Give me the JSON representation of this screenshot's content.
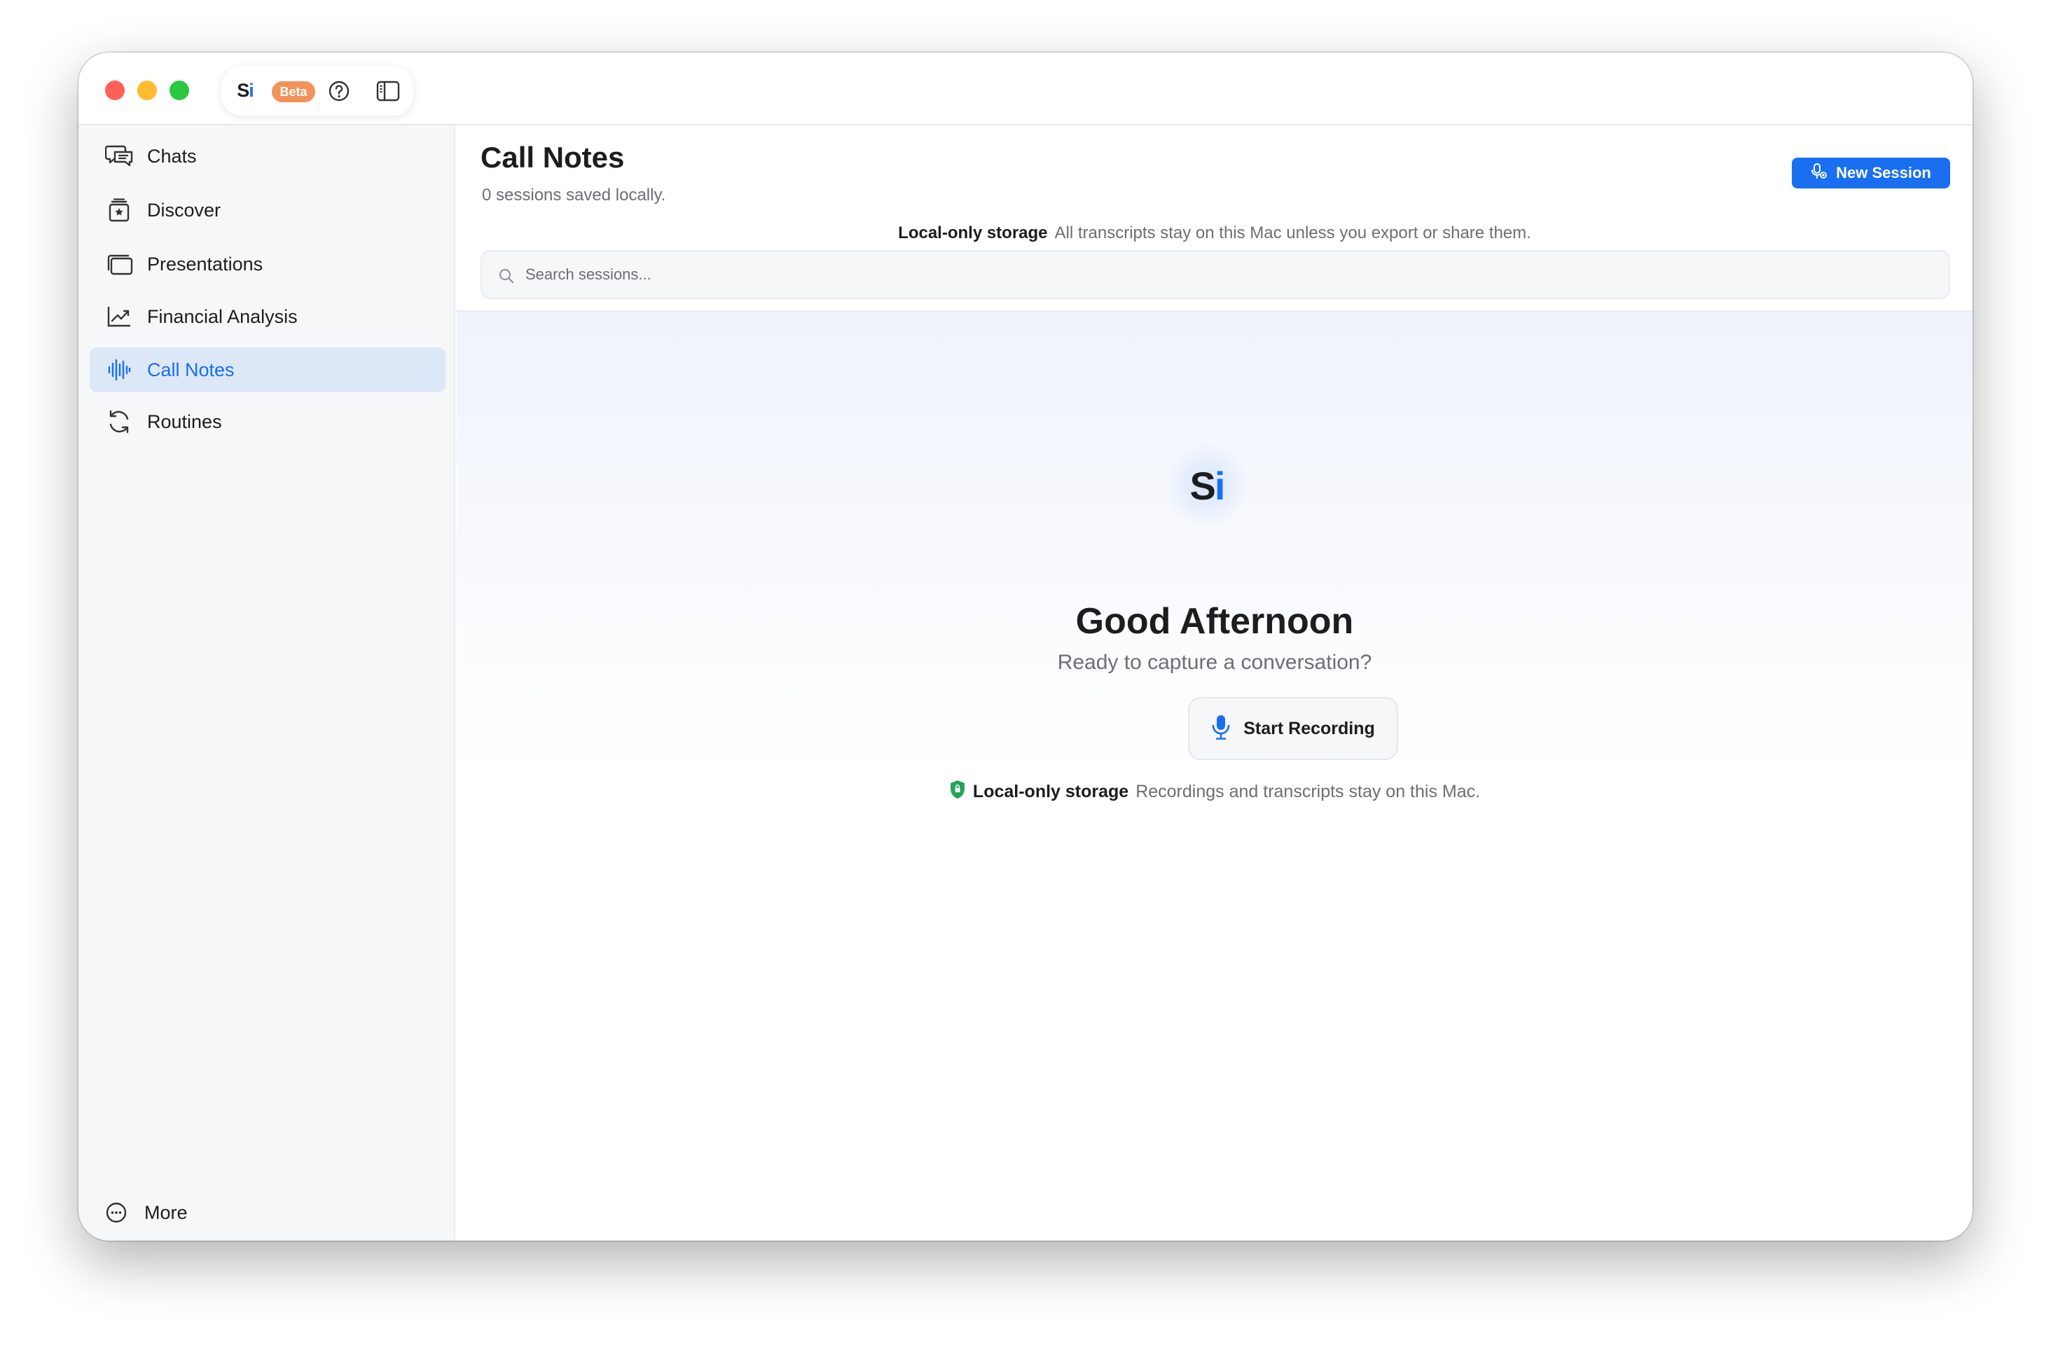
{
  "titlebar": {
    "logo_s": "S",
    "logo_i": "i",
    "beta": "Beta",
    "icons": [
      "help-icon",
      "sidebar-toggle-icon"
    ]
  },
  "sidebar": {
    "items": [
      {
        "label": "Chats",
        "icon": "chat-bubbles-icon"
      },
      {
        "label": "Discover",
        "icon": "discover-icon"
      },
      {
        "label": "Presentations",
        "icon": "presentations-icon"
      },
      {
        "label": "Financial Analysis",
        "icon": "chart-line-icon"
      },
      {
        "label": "Call Notes",
        "icon": "waveform-icon",
        "active": true
      },
      {
        "label": "Routines",
        "icon": "refresh-icon"
      }
    ],
    "more": {
      "label": "More",
      "icon": "more-icon"
    }
  },
  "main": {
    "title": "Call Notes",
    "subtitle": "0 sessions saved locally.",
    "new_session": "New Session",
    "storage_strong": "Local-only storage",
    "storage_muted": "All transcripts stay on this Mac unless you export or share them.",
    "search_placeholder": "Search sessions...",
    "hero": {
      "logo_s": "S",
      "logo_i": "i",
      "greeting": "Good Afternoon",
      "subtitle": "Ready to capture a conversation?",
      "start_recording": "Start Recording",
      "note_strong": "Local-only storage",
      "note_muted": "Recordings and transcripts stay on this Mac."
    }
  },
  "colors": {
    "accent": "#1a6ff0",
    "beta": "#f3925a",
    "shield": "#22a55a",
    "sidebar_bg": "#f6f7f9",
    "active_bg": "#dce8f8"
  }
}
